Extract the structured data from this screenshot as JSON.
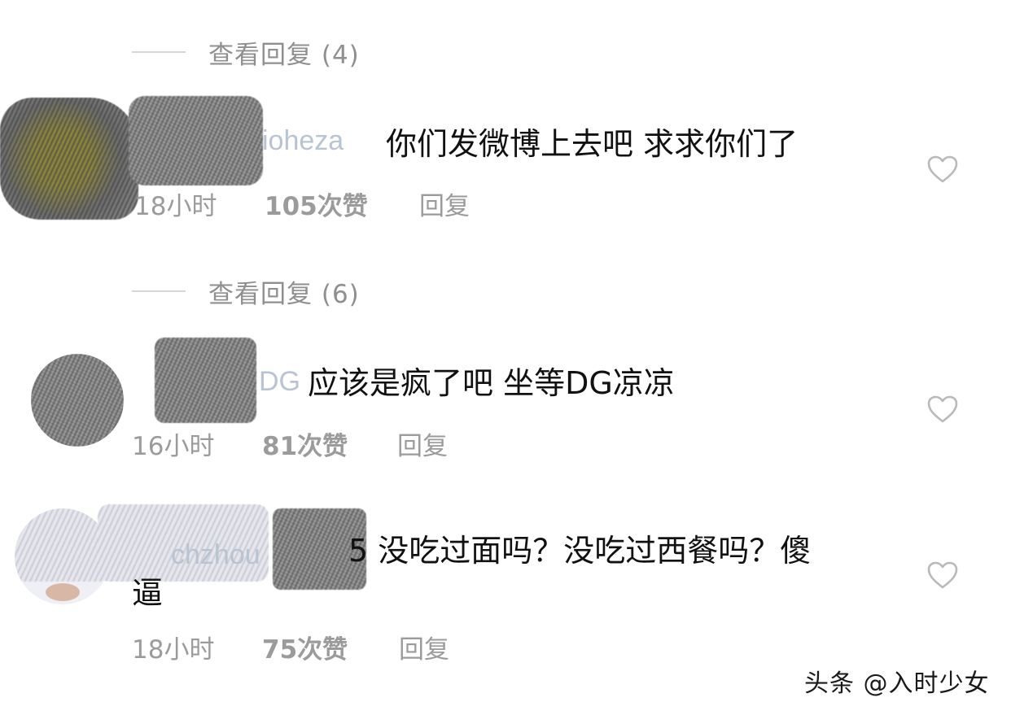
{
  "comments": [
    {
      "view_replies": "查看回复 (4)",
      "name_fragment": "ioheza",
      "text": "你们发微博上去吧 求求你们了",
      "time": "18小时",
      "likes": "105次赞",
      "reply": "回复"
    },
    {
      "view_replies": "查看回复 (6)",
      "name_fragment": "DG",
      "text": "应该是疯了吧 坐等DG凉凉",
      "time": "16小时",
      "likes": "81次赞",
      "reply": "回复"
    },
    {
      "name_fragment": "chzhou",
      "text_line1": "5 没吃过面吗？没吃过西餐吗？傻",
      "text_line2": "逼",
      "time": "18小时",
      "likes": "75次赞",
      "reply": "回复"
    }
  ],
  "watermark": "头条 @入时少女",
  "icons": {
    "like": "heart-outline-icon"
  }
}
